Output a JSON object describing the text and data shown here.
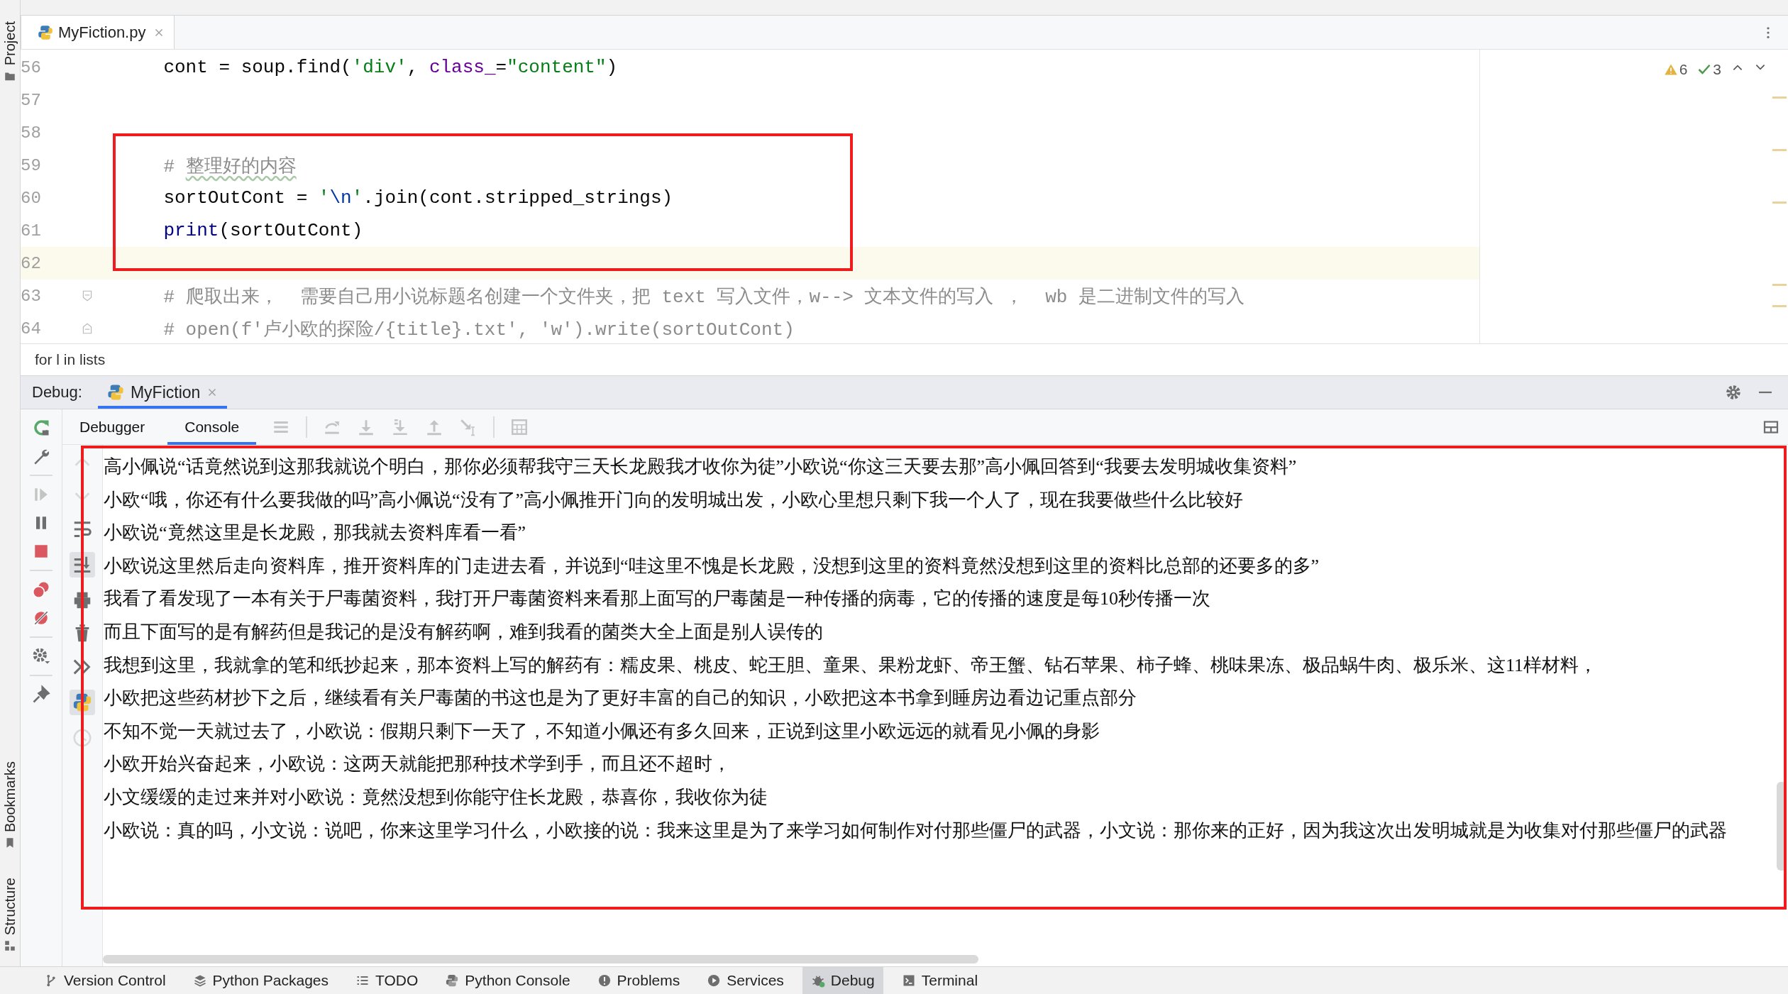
{
  "left_stripe": {
    "top": [
      {
        "label": "Project"
      }
    ],
    "bottom": [
      {
        "label": "Bookmarks"
      },
      {
        "label": "Structure"
      }
    ]
  },
  "editor_tabs": [
    {
      "label": "MyFiction.py",
      "selected": true
    }
  ],
  "inspections": {
    "warnings": "6",
    "passed": "3"
  },
  "code_lines": [
    {
      "number": "56",
      "current": false,
      "fold_start": false,
      "fold_end": false,
      "tokens": [
        {
          "kind": "plain",
          "text": "    cont = soup.find("
        },
        {
          "kind": "string",
          "text": "'div'"
        },
        {
          "kind": "plain",
          "text": ", "
        },
        {
          "kind": "param",
          "text": "class_"
        },
        {
          "kind": "plain",
          "text": "="
        },
        {
          "kind": "string",
          "text": "\"content\""
        },
        {
          "kind": "plain",
          "text": ")"
        }
      ]
    },
    {
      "number": "57",
      "current": false,
      "fold_start": false,
      "fold_end": false
    },
    {
      "number": "58",
      "current": false,
      "fold_start": false,
      "fold_end": false
    },
    {
      "number": "59",
      "current": false,
      "fold_start": false,
      "fold_end": false,
      "tokens": [
        {
          "kind": "comment",
          "text": "    # "
        },
        {
          "kind": "comment-typo",
          "text": "整理好的内容"
        }
      ]
    },
    {
      "number": "60",
      "current": false,
      "fold_start": false,
      "fold_end": false,
      "tokens": [
        {
          "kind": "plain",
          "text": "    sortOutCont = "
        },
        {
          "kind": "string",
          "text": "'"
        },
        {
          "kind": "escape",
          "text": "\\n"
        },
        {
          "kind": "string",
          "text": "'"
        },
        {
          "kind": "plain",
          "text": ".join(cont.stripped_strings)"
        }
      ]
    },
    {
      "number": "61",
      "current": false,
      "fold_start": false,
      "fold_end": false,
      "tokens": [
        {
          "kind": "builtin",
          "text": "    print"
        },
        {
          "kind": "plain",
          "text": "(sortOutCont)"
        }
      ]
    },
    {
      "number": "62",
      "current": true,
      "fold_start": false,
      "fold_end": false
    },
    {
      "number": "63",
      "current": false,
      "fold_start": true,
      "fold_end": false,
      "tokens": [
        {
          "kind": "comment",
          "text": "    # 爬取出来，  需要自己用小说标题名创建一个文件夹，把 text 写入文件，w--> 文本文件的写入 ，  wb 是二进制文件的写入"
        }
      ]
    },
    {
      "number": "64",
      "current": false,
      "fold_start": false,
      "fold_end": true,
      "tokens": [
        {
          "kind": "comment",
          "text": "    # open(f'卢小欧的探险/{title}.txt', 'w').write(sortOutCont)"
        }
      ]
    }
  ],
  "breadcrumb": "for l in lists",
  "debug": {
    "title": "Debug:",
    "run_tabs": [
      {
        "label": "MyFiction",
        "selected": true
      }
    ],
    "tabs": [
      {
        "label": "Debugger",
        "selected": false
      },
      {
        "label": "Console",
        "selected": true
      }
    ],
    "console_lines": [
      "高小佩说“话竟然说到这那我就说个明白，那你必须帮我守三天长龙殿我才收你为徒”小欧说“你这三天要去那”高小佩回答到“我要去发明城收集资料”",
      "小欧“哦，你还有什么要我做的吗”高小佩说“没有了”高小佩推开门向的发明城出发，小欧心里想只剩下我一个人了，现在我要做些什么比较好",
      "小欧说“竟然这里是长龙殿，那我就去资料库看一看”",
      "小欧说这里然后走向资料库，推开资料库的门走进去看，并说到“哇这里不愧是长龙殿，没想到这里的资料竟然没想到这里的资料比总部的还要多的多”",
      "我看了看发现了一本有关于尸毒菌资料，我打开尸毒菌资料来看那上面写的尸毒菌是一种传播的病毒，它的传播的速度是每10秒传播一次",
      "而且下面写的是有解药但是我记的是没有解药啊，难到我看的菌类大全上面是别人误传的",
      "我想到这里，我就拿的笔和纸抄起来，那本资料上写的解药有：糯皮果、桃皮、蛇王胆、童果、果粉龙虾、帝王蟹、钻石苹果、柿子蜂、桃味果冻、极品蜗牛肉、极乐米、这11样材料，",
      "小欧把这些药材抄下之后，继续看有关尸毒菌的书这也是为了更好丰富的自己的知识，小欧把这本书拿到睡房边看边记重点部分",
      "不知不觉一天就过去了，小欧说：假期只剩下一天了，不知道小佩还有多久回来，正说到这里小欧远远的就看见小佩的身影",
      "小欧开始兴奋起来，小欧说：这两天就能把那种技术学到手，而且还不超时，",
      "小文缓缓的走过来并对小欧说：竟然没想到你能守住长龙殿，恭喜你，我收你为徒",
      "小欧说：真的吗，小文说：说吧，你来这里学习什么，小欧接的说：我来这里是为了来学习如何制作对付那些僵尸的武器，小文说：那你来的正好，因为我这次出发明城就是为收集对付那些僵尸的武器"
    ]
  },
  "tool_windows": [
    {
      "label": "Version Control",
      "selected": false
    },
    {
      "label": "Python Packages",
      "selected": false
    },
    {
      "label": "TODO",
      "selected": false
    },
    {
      "label": "Python Console",
      "selected": false
    },
    {
      "label": "Problems",
      "selected": false
    },
    {
      "label": "Services",
      "selected": false
    },
    {
      "label": "Debug",
      "selected": true
    },
    {
      "label": "Terminal",
      "selected": false
    }
  ]
}
